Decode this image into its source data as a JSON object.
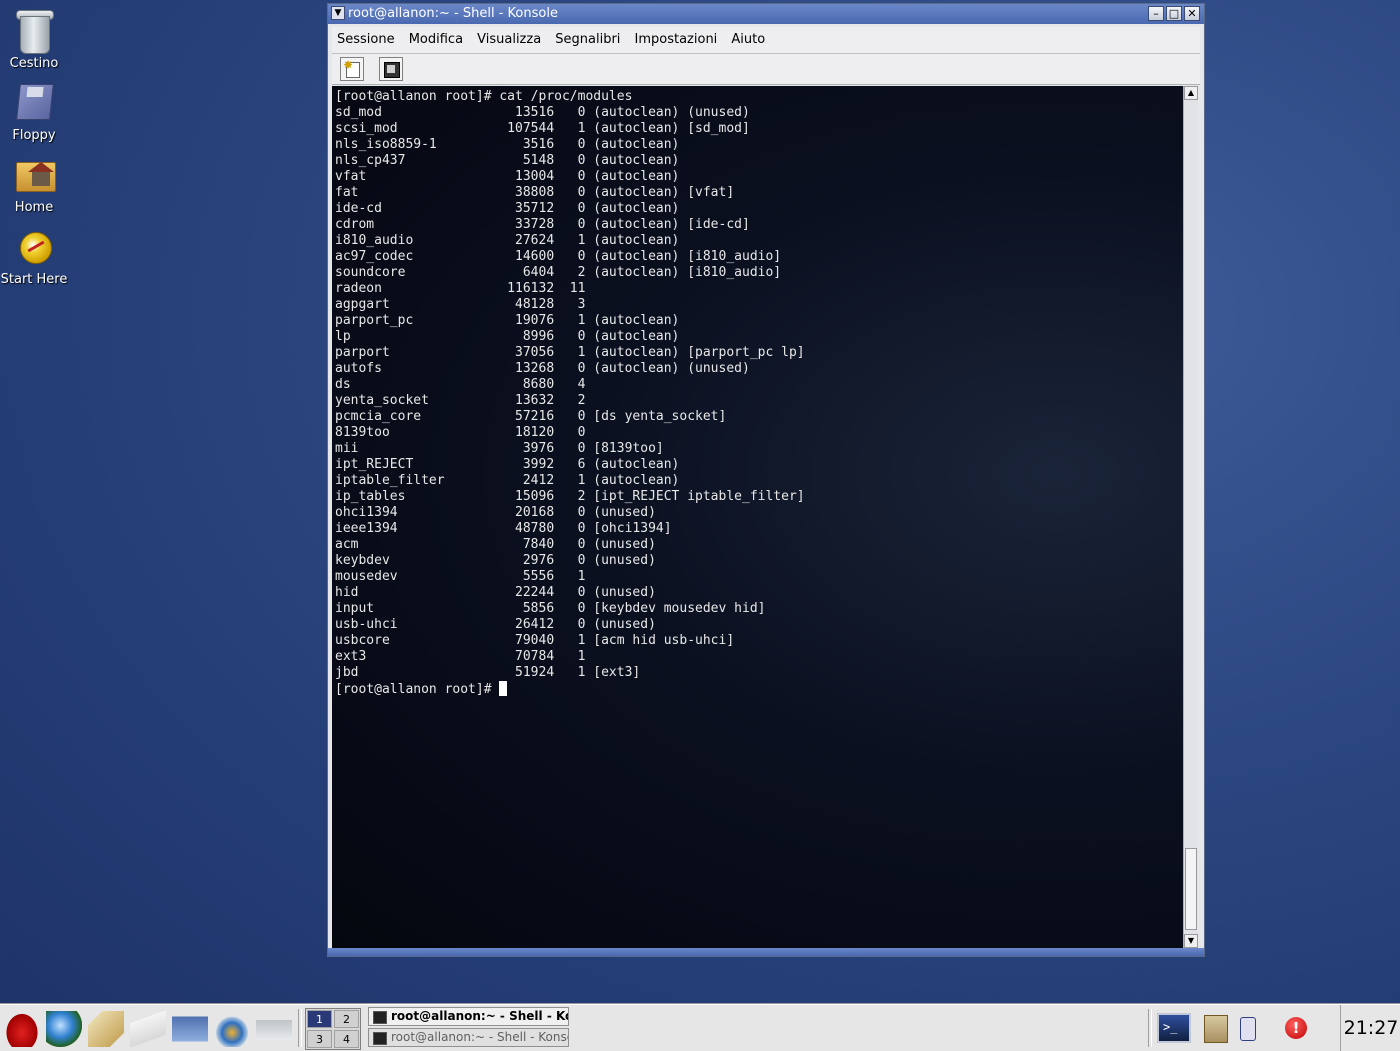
{
  "desktop": {
    "icons": [
      {
        "label": "Cestino",
        "icon": "trash-icon"
      },
      {
        "label": "Floppy",
        "icon": "floppy-icon"
      },
      {
        "label": "Home",
        "icon": "home-folder-icon"
      },
      {
        "label": "Start Here",
        "icon": "start-here-icon"
      }
    ]
  },
  "window": {
    "title": "root@allanon:~ - Shell - Konsole",
    "menu": [
      "Sessione",
      "Modifica",
      "Visualizza",
      "Segnalibri",
      "Impostazioni",
      "Aiuto"
    ],
    "toolbar": [
      {
        "icon": "new-session-icon"
      },
      {
        "icon": "configure-icon"
      }
    ]
  },
  "terminal": {
    "prompt_line": "[root@allanon root]# cat /proc/modules",
    "modules": [
      {
        "name": "sd_mod",
        "size": "13516",
        "used": "0",
        "flags": "(autoclean) (unused)"
      },
      {
        "name": "scsi_mod",
        "size": "107544",
        "used": "1",
        "flags": "(autoclean) [sd_mod]"
      },
      {
        "name": "nls_iso8859-1",
        "size": "3516",
        "used": "0",
        "flags": "(autoclean)"
      },
      {
        "name": "nls_cp437",
        "size": "5148",
        "used": "0",
        "flags": "(autoclean)"
      },
      {
        "name": "vfat",
        "size": "13004",
        "used": "0",
        "flags": "(autoclean)"
      },
      {
        "name": "fat",
        "size": "38808",
        "used": "0",
        "flags": "(autoclean) [vfat]"
      },
      {
        "name": "ide-cd",
        "size": "35712",
        "used": "0",
        "flags": "(autoclean)"
      },
      {
        "name": "cdrom",
        "size": "33728",
        "used": "0",
        "flags": "(autoclean) [ide-cd]"
      },
      {
        "name": "i810_audio",
        "size": "27624",
        "used": "1",
        "flags": "(autoclean)"
      },
      {
        "name": "ac97_codec",
        "size": "14600",
        "used": "0",
        "flags": "(autoclean) [i810_audio]"
      },
      {
        "name": "soundcore",
        "size": "6404",
        "used": "2",
        "flags": "(autoclean) [i810_audio]"
      },
      {
        "name": "radeon",
        "size": "116132",
        "used": "11",
        "flags": ""
      },
      {
        "name": "agpgart",
        "size": "48128",
        "used": "3",
        "flags": ""
      },
      {
        "name": "parport_pc",
        "size": "19076",
        "used": "1",
        "flags": "(autoclean)"
      },
      {
        "name": "lp",
        "size": "8996",
        "used": "0",
        "flags": "(autoclean)"
      },
      {
        "name": "parport",
        "size": "37056",
        "used": "1",
        "flags": "(autoclean) [parport_pc lp]"
      },
      {
        "name": "autofs",
        "size": "13268",
        "used": "0",
        "flags": "(autoclean) (unused)"
      },
      {
        "name": "ds",
        "size": "8680",
        "used": "4",
        "flags": ""
      },
      {
        "name": "yenta_socket",
        "size": "13632",
        "used": "2",
        "flags": ""
      },
      {
        "name": "pcmcia_core",
        "size": "57216",
        "used": "0",
        "flags": "[ds yenta_socket]"
      },
      {
        "name": "8139too",
        "size": "18120",
        "used": "0",
        "flags": ""
      },
      {
        "name": "mii",
        "size": "3976",
        "used": "0",
        "flags": "[8139too]"
      },
      {
        "name": "ipt_REJECT",
        "size": "3992",
        "used": "6",
        "flags": "(autoclean)"
      },
      {
        "name": "iptable_filter",
        "size": "2412",
        "used": "1",
        "flags": "(autoclean)"
      },
      {
        "name": "ip_tables",
        "size": "15096",
        "used": "2",
        "flags": "[ipt_REJECT iptable_filter]"
      },
      {
        "name": "ohci1394",
        "size": "20168",
        "used": "0",
        "flags": "(unused)"
      },
      {
        "name": "ieee1394",
        "size": "48780",
        "used": "0",
        "flags": "[ohci1394]"
      },
      {
        "name": "acm",
        "size": "7840",
        "used": "0",
        "flags": "(unused)"
      },
      {
        "name": "keybdev",
        "size": "2976",
        "used": "0",
        "flags": "(unused)"
      },
      {
        "name": "mousedev",
        "size": "5556",
        "used": "1",
        "flags": ""
      },
      {
        "name": "hid",
        "size": "22244",
        "used": "0",
        "flags": "(unused)"
      },
      {
        "name": "input",
        "size": "5856",
        "used": "0",
        "flags": "[keybdev mousedev hid]"
      },
      {
        "name": "usb-uhci",
        "size": "26412",
        "used": "0",
        "flags": "(unused)"
      },
      {
        "name": "usbcore",
        "size": "79040",
        "used": "1",
        "flags": "[acm hid usb-uhci]"
      },
      {
        "name": "ext3",
        "size": "70784",
        "used": "1",
        "flags": ""
      },
      {
        "name": "jbd",
        "size": "51924",
        "used": "1",
        "flags": "[ext3]"
      }
    ],
    "final_prompt": "[root@allanon root]# "
  },
  "taskbar": {
    "launchers": [
      {
        "icon": "redhat-menu-icon"
      },
      {
        "icon": "web-browser-icon"
      },
      {
        "icon": "email-icon"
      },
      {
        "icon": "writer-icon"
      },
      {
        "icon": "spreadsheet-icon"
      },
      {
        "icon": "presentation-icon"
      },
      {
        "icon": "printer-icon"
      }
    ],
    "pager": [
      "1",
      "2",
      "3",
      "4"
    ],
    "active_desktop": "1",
    "tasks": [
      {
        "label": "root@allanon:~ - Shell - Konsole",
        "state": "active"
      },
      {
        "label": "root@allanon:~ - Shell - Konsole",
        "state": "inactive"
      }
    ],
    "tray": [
      {
        "icon": "terminal-icon",
        "text": ">_"
      },
      {
        "icon": "klipper-icon"
      },
      {
        "icon": "usb-icon"
      },
      {
        "icon": "alert-icon",
        "text": "!"
      }
    ],
    "clock": "21:27"
  }
}
